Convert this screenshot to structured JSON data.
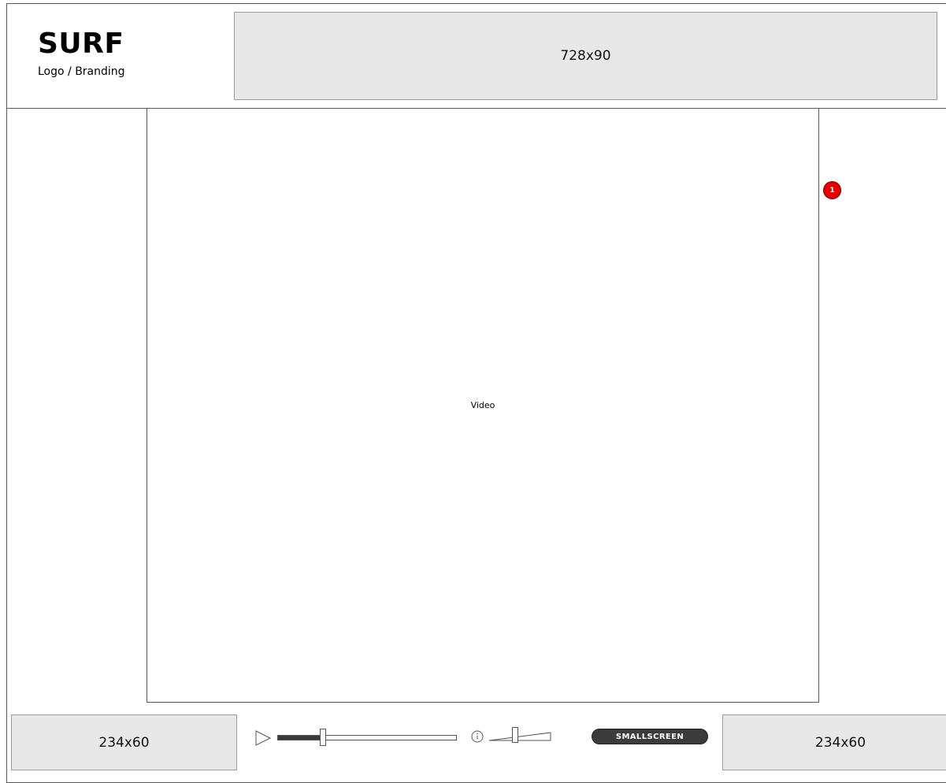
{
  "header": {
    "logo_title": "SURF",
    "logo_subtitle": "Logo / Branding",
    "banner_ad_label": "728x90"
  },
  "player": {
    "video_label": "Video",
    "annotation_badge": "1",
    "seek_progress": 0.24,
    "volume_level": 0.45,
    "smallscreen_label": "SMALLSCREEN"
  },
  "footer": {
    "left_ad_label": "234x60",
    "right_ad_label": "234x60"
  },
  "colors": {
    "ad_fill": "#e8e8e8",
    "badge": "#e60000",
    "button_dark": "#3b3b3b"
  },
  "icons": [
    "play-icon",
    "info-icon",
    "volume-icon"
  ]
}
